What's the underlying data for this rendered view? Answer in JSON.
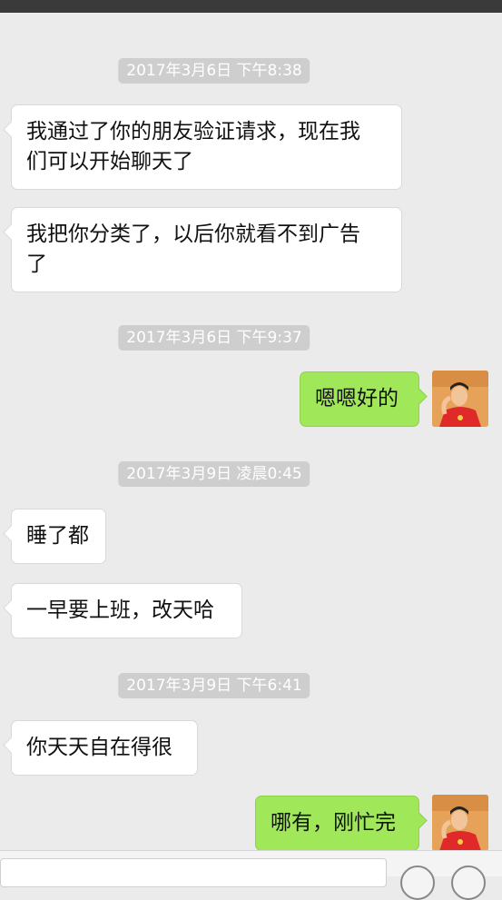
{
  "timestamps": {
    "t1": "2017年3月6日 下午8:38",
    "t2": "2017年3月6日 下午9:37",
    "t3": "2017年3月9日 凌晨0:45",
    "t4": "2017年3月9日 下午6:41"
  },
  "messages": {
    "m1_line1": "我通过了你的朋友验证请求，现在我",
    "m1_line2": "们可以开始聊天了",
    "m2_line1": "我把你分类了，以后你就看不到广告",
    "m2_line2": "了",
    "m3": "嗯嗯好的",
    "m4": "睡了都",
    "m5": "一早要上班，改天哈",
    "m6": "你天天自在得很",
    "m7": "哪有，刚忙完"
  },
  "colors": {
    "background": "#ebebeb",
    "sent_bubble": "#a0e75a",
    "received_bubble": "#ffffff",
    "timestamp_badge": "#cecece"
  }
}
